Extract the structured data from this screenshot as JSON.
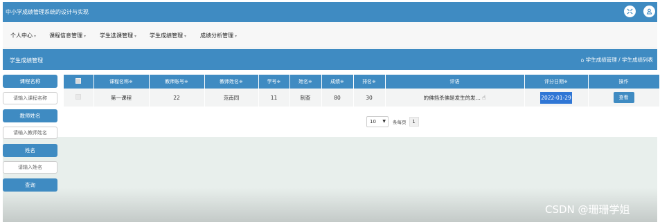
{
  "app": {
    "title": "中小学成绩管理系统的设计与实现"
  },
  "top_icons": [
    "fullscreen-icon",
    "user-icon"
  ],
  "menu": [
    {
      "label": "个人中心",
      "caret": "▾"
    },
    {
      "label": "课程信息管理",
      "caret": "▾"
    },
    {
      "label": "学生选课管理",
      "caret": "▾"
    },
    {
      "label": "学生成绩管理",
      "caret": "▾"
    },
    {
      "label": "成绩分析管理",
      "caret": "▾"
    }
  ],
  "page": {
    "title": "学生成绩管理",
    "breadcrumb": "学生成绩管理 / 学生成绩列表",
    "home_glyph": "⌂"
  },
  "filters": {
    "course_label": "课程名称",
    "course_placeholder": "请输入课程名称",
    "teacher_label": "教师姓名",
    "teacher_placeholder": "请输入教师姓名",
    "name_label": "姓名",
    "name_placeholder": "请输入姓名",
    "search_button": "查询"
  },
  "table": {
    "headers": [
      "课程名称≑",
      "教师账号≑",
      "教师姓名≑",
      "学号≑",
      "姓名≑",
      "成绩≑",
      "排名≑",
      "评语",
      "评分日期≑",
      "操作"
    ],
    "rows": [
      {
        "course": "第一课程",
        "teacher_account": "22",
        "teacher_name": "范南同",
        "student_no": "11",
        "name": "制查",
        "score": "80",
        "rank": "30",
        "comment": "的佛挡杀佛是发生的发...",
        "date": "2022-01-29",
        "action": "查看"
      }
    ]
  },
  "pager": {
    "page_size": "10",
    "per_page_label": "条每页",
    "current_page": "1"
  },
  "watermark": "CSDN @珊珊学姐",
  "colors": {
    "primary": "#3f8bc2",
    "selection": "#2f76d5"
  }
}
